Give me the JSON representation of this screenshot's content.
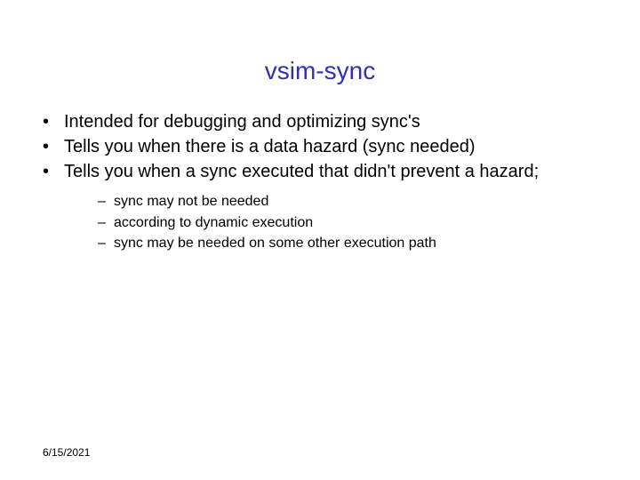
{
  "title": "vsim-sync",
  "bullets": [
    "Intended for debugging and optimizing sync's",
    "Tells you when there is a data hazard (sync needed)",
    "Tells you when a sync executed that didn't prevent a hazard;"
  ],
  "sub_bullets": [
    "sync may not be needed",
    "according to dynamic execution",
    "sync may be needed on some other execution path"
  ],
  "date": "6/15/2021"
}
